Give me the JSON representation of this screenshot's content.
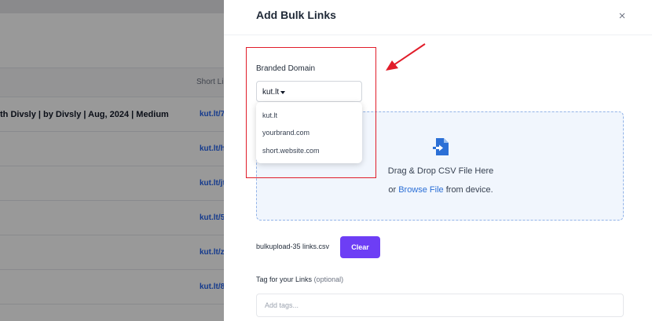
{
  "background": {
    "column_header": "Short Lin",
    "rows": [
      {
        "title": "th Divsly | by Divsly | Aug, 2024 | Medium",
        "link": "kut.lt/7"
      },
      {
        "title": "",
        "link": "kut.lt/h"
      },
      {
        "title": "",
        "link": "kut.lt/jt"
      },
      {
        "title": "",
        "link": "kut.lt/5"
      },
      {
        "title": "",
        "link": "kut.lt/zv"
      },
      {
        "title": "",
        "link": "kut.lt/8"
      }
    ]
  },
  "modal": {
    "title": "Add Bulk Links",
    "branded_domain": {
      "label": "Branded Domain",
      "selected": "kut.lt",
      "options": [
        "kut.lt",
        "yourbrand.com",
        "short.website.com"
      ]
    },
    "dropzone": {
      "main_text": "Drag & Drop CSV File Here",
      "prefix": "or",
      "link_text": "Browse File",
      "suffix": "from device."
    },
    "upload": {
      "file_name": "bulkupload-35 links.csv",
      "clear_label": "Clear"
    },
    "tags": {
      "label": "Tag for your Links",
      "optional": "(optional)",
      "placeholder": "Add tags..."
    }
  },
  "colors": {
    "accent": "#6d3ef5",
    "link": "#2b6fd6",
    "annotation": "#e11d2a"
  }
}
